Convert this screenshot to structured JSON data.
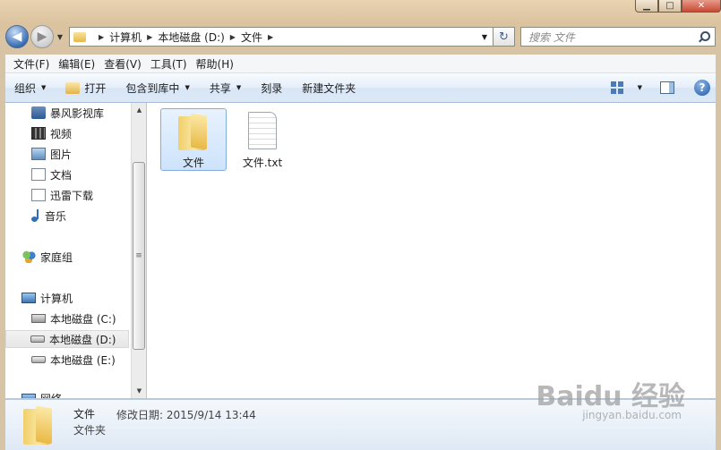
{
  "window": {
    "min_glyph": "▁",
    "max_glyph": "□",
    "close_glyph": "✕"
  },
  "nav": {
    "back_glyph": "◀",
    "forward_glyph": "▶",
    "breadcrumb": [
      "计算机",
      "本地磁盘 (D:)",
      "文件"
    ],
    "search_placeholder": "搜索 文件",
    "refresh_glyph": "↻"
  },
  "menu": [
    "文件(F)",
    "编辑(E)",
    "查看(V)",
    "工具(T)",
    "帮助(H)"
  ],
  "toolbar": {
    "organize": "组织",
    "open": "打开",
    "include_library": "包含到库中",
    "share": "共享",
    "burn": "刻录",
    "new_folder": "新建文件夹",
    "help_glyph": "?"
  },
  "sidebar": {
    "items": [
      {
        "label": "暴风影视库",
        "icon": "library-icon"
      },
      {
        "label": "视频",
        "icon": "video-icon"
      },
      {
        "label": "图片",
        "icon": "pictures-icon"
      },
      {
        "label": "文档",
        "icon": "documents-icon"
      },
      {
        "label": "迅雷下载",
        "icon": "download-icon"
      },
      {
        "label": "音乐",
        "icon": "music-icon"
      },
      {
        "label": "家庭组",
        "icon": "homegroup-icon"
      },
      {
        "label": "计算机",
        "icon": "computer-icon"
      },
      {
        "label": "本地磁盘 (C:)",
        "icon": "drive-c-icon"
      },
      {
        "label": "本地磁盘 (D:)",
        "icon": "drive-icon",
        "selected": true
      },
      {
        "label": "本地磁盘 (E:)",
        "icon": "drive-icon"
      },
      {
        "label": "网络",
        "icon": "network-icon"
      }
    ]
  },
  "files": [
    {
      "name": "文件",
      "type": "folder",
      "selected": true
    },
    {
      "name": "文件.txt",
      "type": "text-file"
    }
  ],
  "details": {
    "name": "文件",
    "modified": "修改日期: 2015/9/14 13:44",
    "type": "文件夹"
  },
  "watermark": {
    "text": "Baidu 经验",
    "url": "jingyan.baidu.com"
  },
  "colors": {
    "toolbar_blue": "#dce8f6",
    "selection": "#cde3fb",
    "frame": "#dcc39f"
  }
}
